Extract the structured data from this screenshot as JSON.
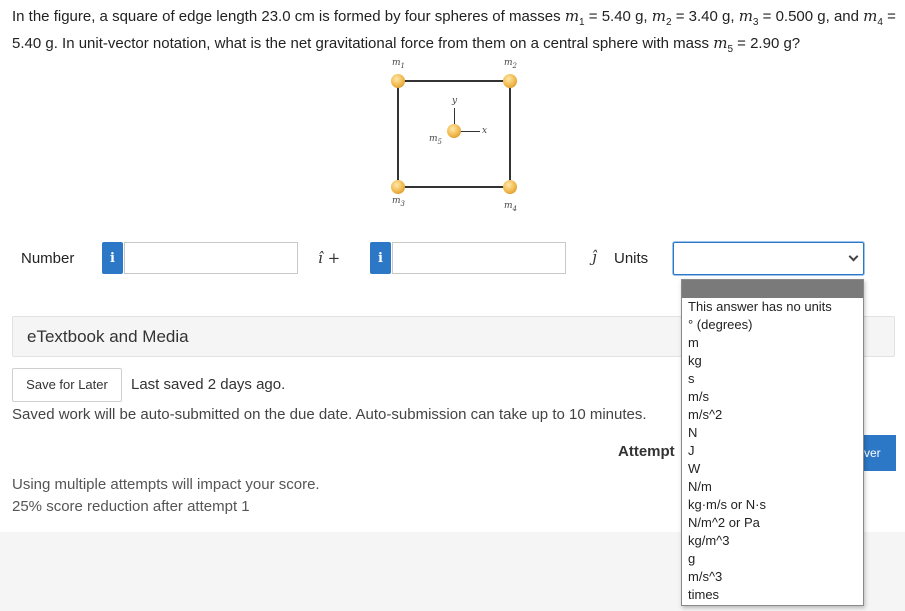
{
  "question": {
    "intro": "In the figure, a square of edge length 23.0 cm is formed by four spheres of masses ",
    "m1_sym": "m",
    "m1_sub": "1",
    "m1_val": " = 5.40 g, ",
    "m2_sym": "m",
    "m2_sub": "2",
    "m2_val": " = 3.40 g, ",
    "m3_sym": "m",
    "m3_sub": "3",
    "m3_val": " = 0.500 g, and ",
    "m4_sym": "m",
    "m4_sub": "4",
    "m4_val": " = 5.40 g. In unit-vector notation, what is the net gravitational force from them on a central sphere with mass ",
    "m5_sym": "m",
    "m5_sub": "5",
    "m5_val": " = 2.90 g?"
  },
  "figure": {
    "m1": "m",
    "m1_sub": "1",
    "m2": "m",
    "m2_sub": "2",
    "m3": "m",
    "m3_sub": "3",
    "m4": "m",
    "m4_sub": "4",
    "m5": "m",
    "m5_sub": "5",
    "y_axis": "y",
    "x_axis": "x"
  },
  "answer": {
    "number_label": "Number",
    "info_glyph": "i",
    "i_hat": "î +",
    "j_hat": "ĵ",
    "units_label": "Units",
    "x_value": "",
    "y_value": ""
  },
  "etextbook": "eTextbook and Media",
  "save": {
    "button": "Save for Later",
    "last_saved": "Last saved 2 days ago.",
    "auto_note": "Saved work will be auto-submitted on the due date. Auto-submission can take up to 10 minutes."
  },
  "attempts": {
    "label": "Attempt",
    "submit_partial": "ver"
  },
  "multi_attempt": {
    "line1": "Using multiple attempts will impact your score.",
    "line2": "25% score reduction after attempt 1"
  },
  "units_options": [
    "This answer has no units",
    "° (degrees)",
    "m",
    "kg",
    "s",
    "m/s",
    "m/s^2",
    "N",
    "J",
    "W",
    "N/m",
    "kg·m/s or N·s",
    "N/m^2 or Pa",
    "kg/m^3",
    "g",
    "m/s^3",
    "times"
  ],
  "colors": {
    "accent": "#2c78c7",
    "sphere": "#f0b64a"
  }
}
